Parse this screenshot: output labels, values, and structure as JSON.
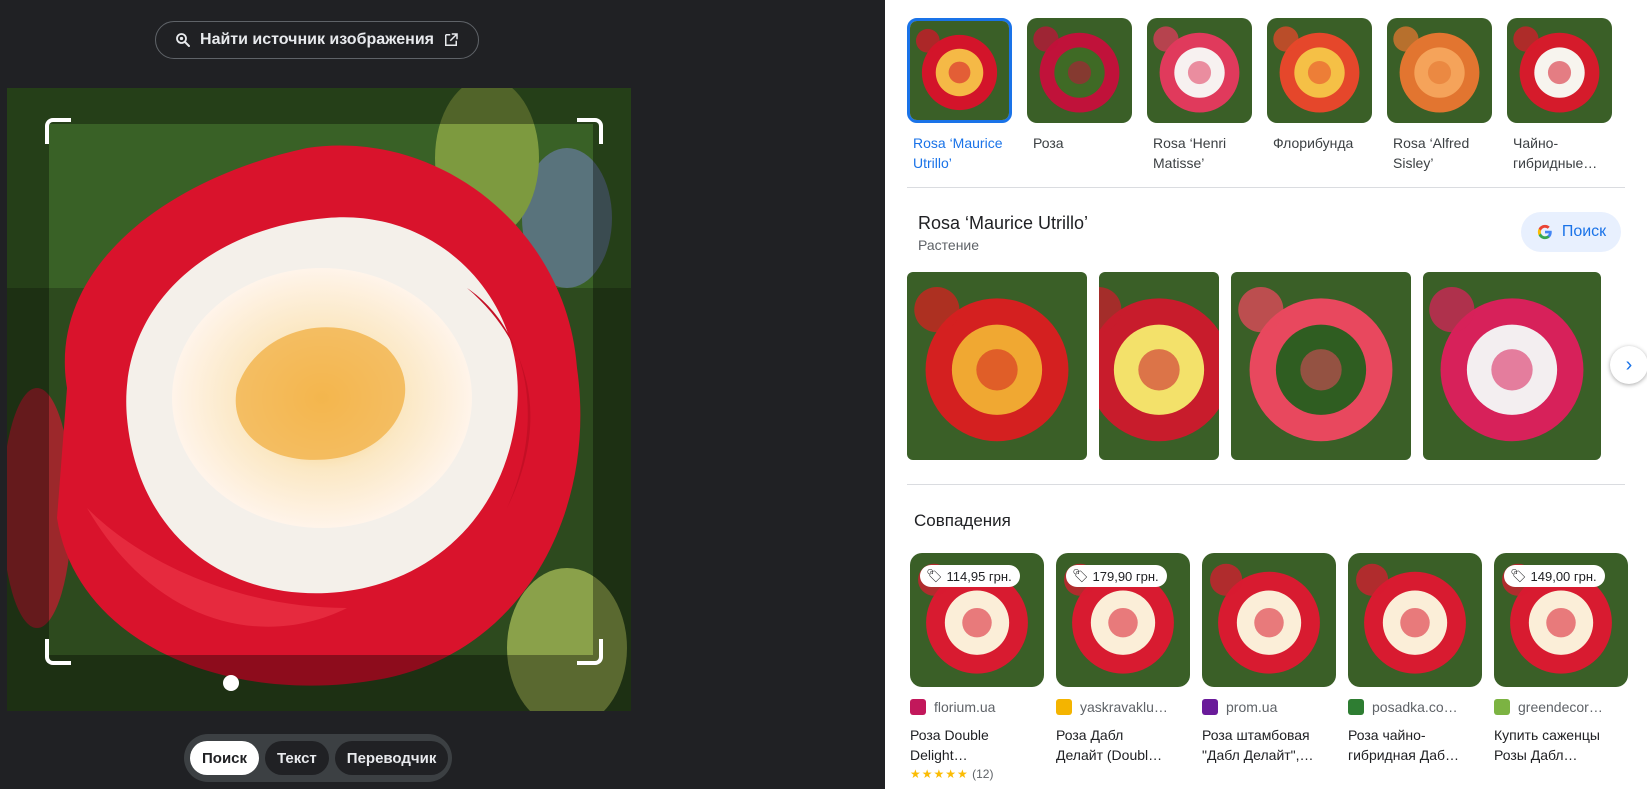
{
  "left_panel": {
    "source_button": {
      "label": "Найти источник изображения",
      "icon": "lens-icon",
      "external_icon": "open-in-new-icon"
    },
    "modes": [
      {
        "label": "Поиск",
        "active": true
      },
      {
        "label": "Текст",
        "active": false
      },
      {
        "label": "Переводчик",
        "active": false
      }
    ]
  },
  "related": [
    {
      "label": "Rosa ‘Maurice Utrillo’",
      "active": true,
      "colors": [
        "#d3142a",
        "#f5b946"
      ]
    },
    {
      "label": "Роза",
      "active": false,
      "colors": [
        "#c0123a",
        "#3f6a25"
      ]
    },
    {
      "label": "Rosa ‘Henri Matisse’",
      "active": false,
      "colors": [
        "#e03a5c",
        "#f7f1f0"
      ]
    },
    {
      "label": "Флорибунда",
      "active": false,
      "colors": [
        "#e5472b",
        "#f5c046"
      ]
    },
    {
      "label": "Rosa ‘Alfred Sisley’",
      "active": false,
      "colors": [
        "#e27530",
        "#f5a35a"
      ]
    },
    {
      "label": "Чайно-гибридные…",
      "active": false,
      "colors": [
        "#d51b2b",
        "#f7f4ee"
      ]
    }
  ],
  "entity": {
    "title": "Rosa ‘Maurice Utrillo’",
    "subtitle": "Растение",
    "search_button": "Поиск",
    "gallery": [
      {
        "colors": [
          "#d42020",
          "#f0a832"
        ],
        "width": 180
      },
      {
        "colors": [
          "#c81c2c",
          "#f3e16a"
        ],
        "width": 120
      },
      {
        "colors": [
          "#e8485e",
          "#2f5d21"
        ],
        "width": 180
      },
      {
        "colors": [
          "#d7215a",
          "#f3eef0"
        ],
        "width": 178
      }
    ]
  },
  "matches": {
    "title": "Совпадения",
    "items": [
      {
        "price": "114,95 грн.",
        "site": "florium.ua",
        "title_line1": "Роза Double",
        "title_line2": "Delight…",
        "stars": "★★★★★",
        "reviews": "(12)",
        "fav_color": "#c2185b"
      },
      {
        "price": "179,90 грн.",
        "site": "yaskravaklu…",
        "title_line1": "Роза Дабл",
        "title_line2": "Делайт (Doubl…",
        "stars": "",
        "reviews": "",
        "fav_color": "#f4b400"
      },
      {
        "price": "",
        "site": "prom.ua",
        "title_line1": "Роза штамбовая",
        "title_line2": "\"Дабл Делайт\",…",
        "stars": "",
        "reviews": "",
        "fav_color": "#6a1b9a"
      },
      {
        "price": "",
        "site": "posadka.co…",
        "title_line1": "Роза чайно-",
        "title_line2": "гибридная Даб…",
        "stars": "",
        "reviews": "",
        "fav_color": "#2e7d32"
      },
      {
        "price": "149,00 грн.",
        "site": "greendecor…",
        "title_line1": "Купить саженцы",
        "title_line2": "Розы Дабл…",
        "stars": "",
        "reviews": "",
        "fav_color": "#7cb342"
      }
    ]
  }
}
